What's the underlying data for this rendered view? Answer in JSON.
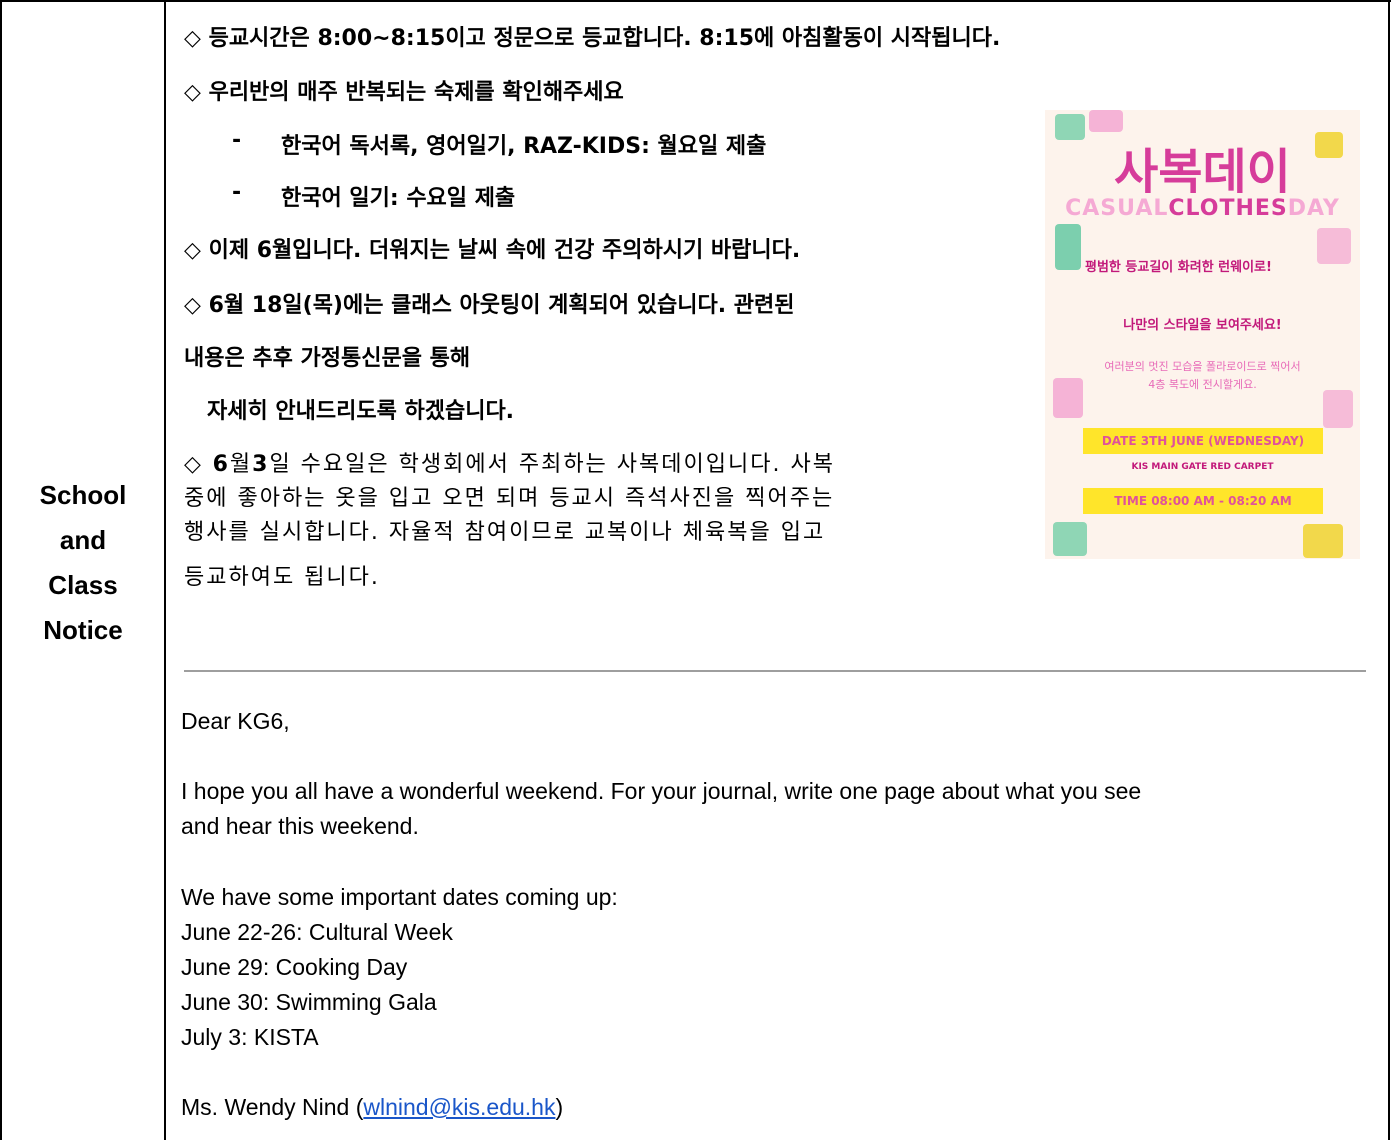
{
  "label": "School\nand\nClass\nNotice",
  "korean": {
    "l1": "◇ 등교시간은 8:00~8:15이고 정문으로 등교합니다. 8:15에 아침활동이 시작됩니다.",
    "l2": "◇  우리반의 매주 반복되는 숙제를 확인해주세요",
    "l3_dash": "-",
    "l3": "한국어 독서록, 영어일기, RAZ-KIDS: 월요일 제출",
    "l4_dash": "-",
    "l4": "한국어 일기: 수요일 제출",
    "l5": "◇ 이제 6월입니다. 더워지는 날씨 속에 건강 주의하시기 바랍니다.",
    "l6": "◇  6월  18일(목)에는  클래스  아웃팅이  계획되어  있습니다.  관련된",
    "l7": "내용은 추후 가정통신문을 통해",
    "l8": "자세히 안내드리도록 하겠습니다.",
    "p1_pre": "◇ ",
    "p1_b1": "6",
    "p1_m1": "월",
    "p1_b2": "3",
    "p1_rest": "일 수요일은 학생회에서 주최하는 사복데이입니다. 사복",
    "p2": "중에 좋아하는 옷을 입고 오면 되며 등교시 즉석사진을 찍어주는",
    "p3": "행사를 실시합니다. 자율적 참여이므로 교복이나 체육복을 입고",
    "p4": "등교하여도 됩니다."
  },
  "poster": {
    "title": "사복데이",
    "sub_a": "CASUAL",
    "sub_b": "CLOTHES",
    "sub_c": "DAY",
    "line1": "평범한 등교길이 화려한 런웨이로!",
    "line2": "나만의 스타일을 보여주세요!",
    "line3": "여러분의 멋진 모습을 폴라로이드로 찍어서\n4층 복도에 전시할게요.",
    "date": "DATE 3TH JUNE (WEDNESDAY)",
    "place": "KIS MAIN GATE RED CARPET",
    "time": "TIME 08:00 AM - 08:20 AM"
  },
  "english": {
    "greeting": "Dear KG6,",
    "para1_l1": "I hope you all have a wonderful weekend. For your journal, write one page about what you see",
    "para1_l2": "and hear this weekend.",
    "dates_intro": "We have some important dates coming up:",
    "dates": [
      "June 22-26: Cultural Week",
      "June 29: Cooking Day",
      "June 30: Swimming Gala",
      "July 3: KISTA"
    ],
    "sign_name": "Ms. Wendy Nind (",
    "sign_email": "wlnind@kis.edu.hk",
    "sign_close": ")"
  }
}
